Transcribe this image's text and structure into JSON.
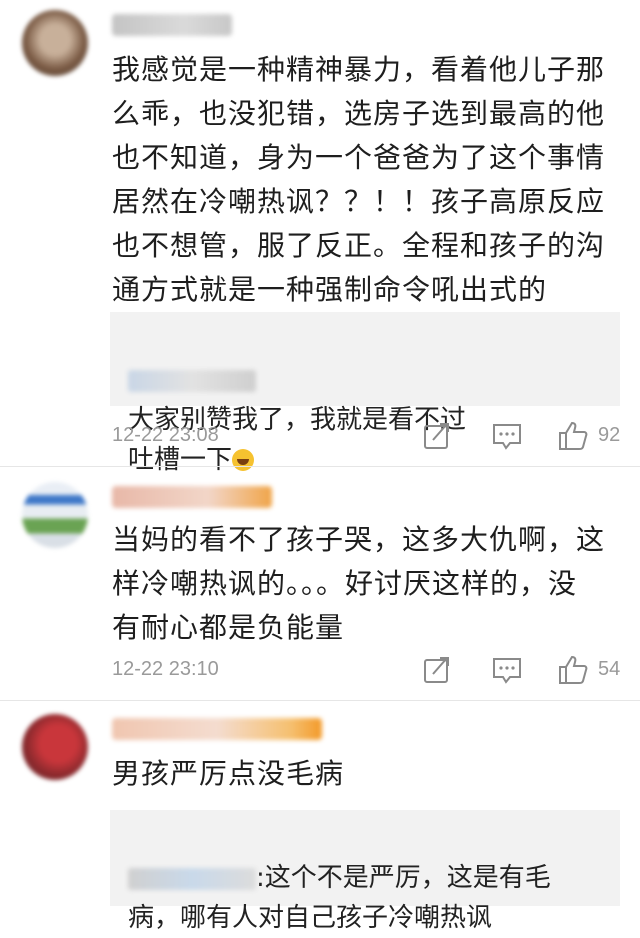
{
  "comments": [
    {
      "text": "我感觉是一种精神暴力，看着他儿子那\n么乖，也没犯错，选房子选到最高的他\n也不知道，身为一个爸爸为了这个事情\n居然在冷嘲热讽？？！！孩子高原反应\n也不想管，服了反正。全程和孩子的沟\n通方式就是一种强制命令吼出式的",
      "reply": {
        "text": "大家别赞我了，我就是看不过\n吐槽一下"
      },
      "time": "12-22 23:08",
      "likes": "92"
    },
    {
      "text": "当妈的看不了孩子哭，这多大仇啊，这\n样冷嘲热讽的。。。好讨厌这样的，没\n有耐心都是负能量",
      "time": "12-22 23:10",
      "likes": "54"
    },
    {
      "text": "男孩严厉点没毛病",
      "reply": {
        "text": ":这个不是严厉，这是有毛\n病，哪有人对自己孩子冷嘲热讽"
      }
    }
  ],
  "icons": [
    "share-icon",
    "comment-icon",
    "like-icon"
  ],
  "colors": {
    "meta": "#9a9a9a",
    "reply_bg": "#f2f2f2"
  }
}
